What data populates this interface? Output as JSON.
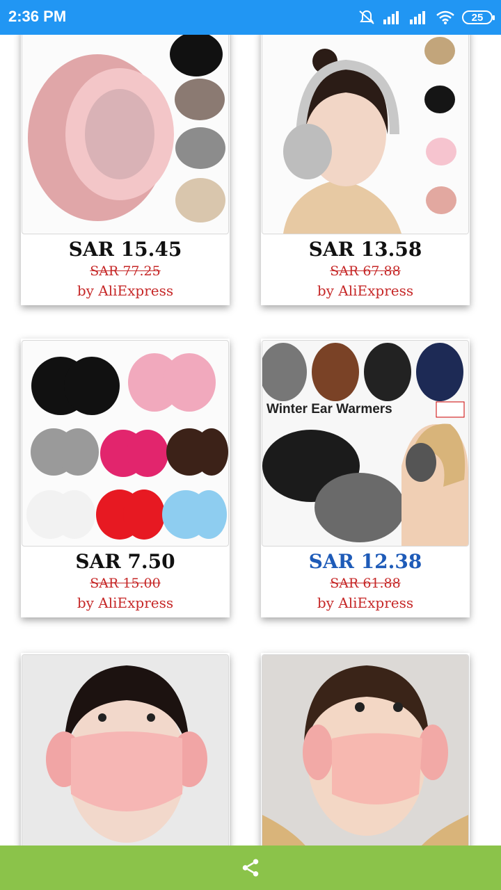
{
  "status": {
    "time": "2:36 PM",
    "battery": "25"
  },
  "products": [
    {
      "price": "SAR 15.45",
      "old_price": "SAR 77.25",
      "seller": "by AliExpress"
    },
    {
      "price": "SAR 13.58",
      "old_price": "SAR 67.88",
      "seller": "by AliExpress"
    },
    {
      "price": "SAR 7.50",
      "old_price": "SAR 15.00",
      "seller": "by AliExpress"
    },
    {
      "price": "SAR 12.38",
      "old_price": "SAR 61.88",
      "seller": "by AliExpress",
      "banner": "Winter Ear Warmers"
    },
    {},
    {}
  ],
  "colors": {
    "status_bar": "#2196f3",
    "bottom_bar": "#8bc34a",
    "sale_red": "#c62828",
    "link_blue": "#1e5bb8"
  },
  "bottom": {
    "icon": "share-icon"
  }
}
